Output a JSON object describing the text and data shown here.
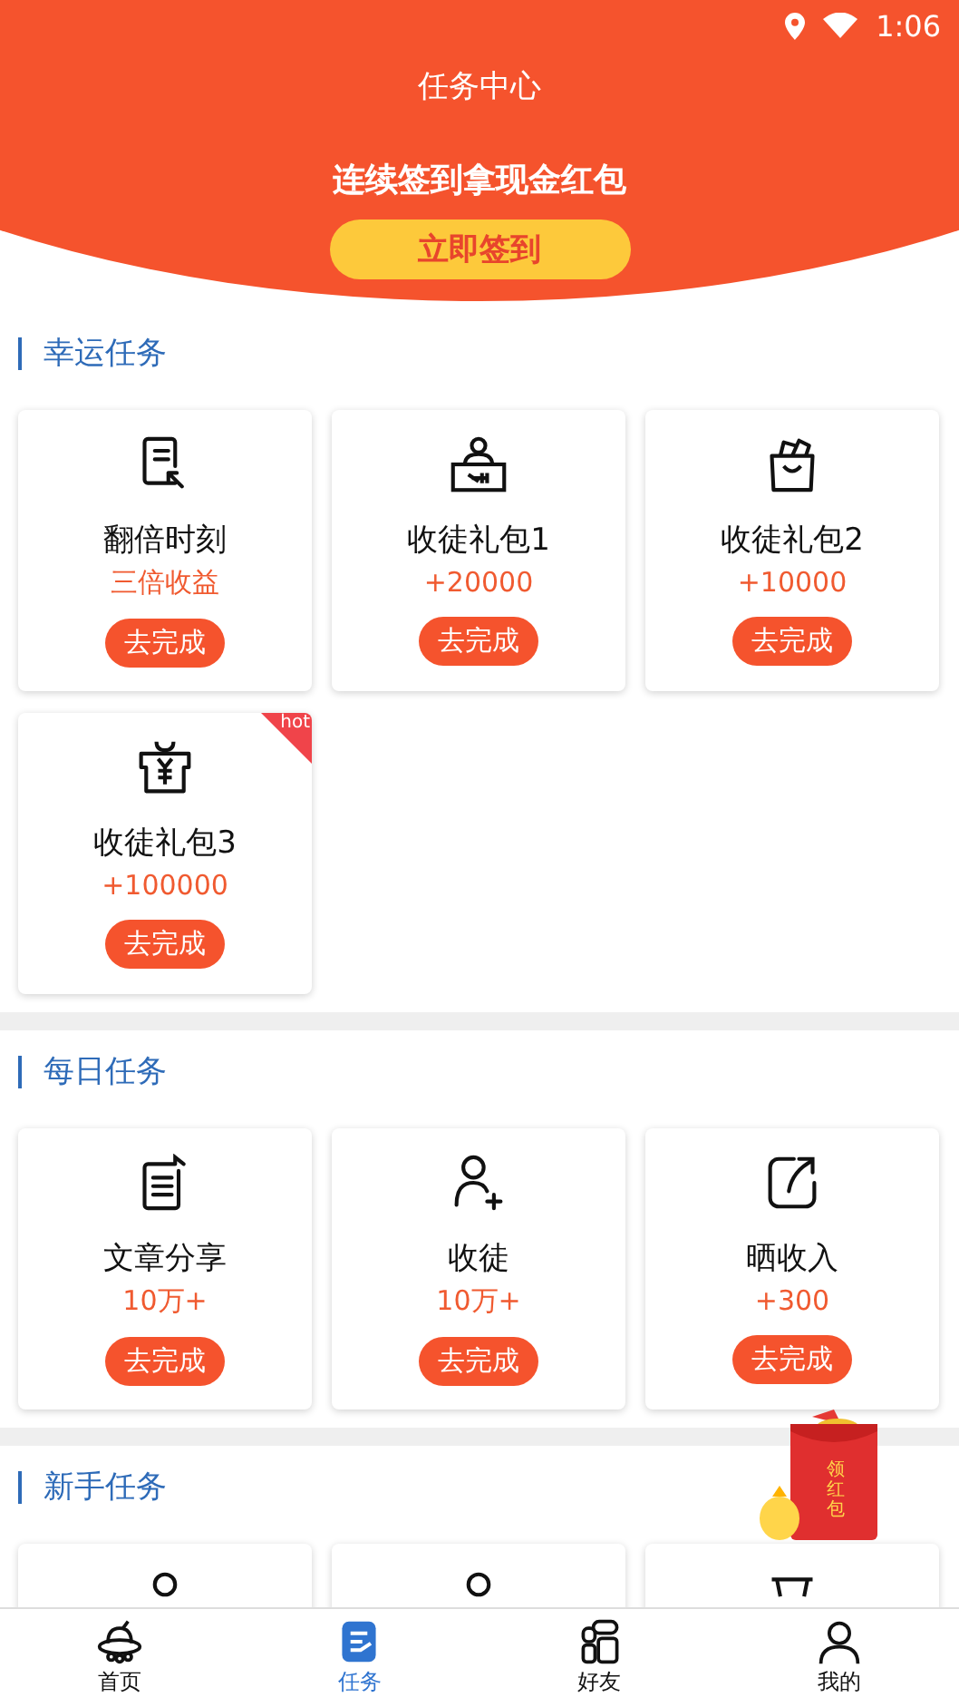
{
  "status_bar": {
    "time": "1:06"
  },
  "header": {
    "title": "任务中心",
    "headline": "连续签到拿现金红包",
    "button": "立即签到"
  },
  "sections": [
    {
      "title": "幸运任务",
      "cards": [
        {
          "kind": "double",
          "name": "翻倍时刻",
          "reward": "三倍收益",
          "button": "去完成"
        },
        {
          "kind": "recruit",
          "name": "收徒礼包1",
          "reward": "+20000",
          "button": "去完成"
        },
        {
          "kind": "bag",
          "name": "收徒礼包2",
          "reward": "+10000",
          "button": "去完成"
        },
        {
          "kind": "gift",
          "name": "收徒礼包3",
          "reward": "+100000",
          "button": "去完成",
          "badge": "hot"
        }
      ]
    },
    {
      "title": "每日任务",
      "cards": [
        {
          "kind": "article",
          "name": "文章分享",
          "reward": "10万+",
          "button": "去完成"
        },
        {
          "kind": "person",
          "name": "收徒",
          "reward": "10万+",
          "button": "去完成"
        },
        {
          "kind": "share",
          "name": "晒收入",
          "reward": "+300",
          "button": "去完成"
        }
      ]
    },
    {
      "title": "新手任务",
      "cards": [
        {
          "kind": "user"
        },
        {
          "kind": "user"
        },
        {
          "kind": "tray"
        }
      ]
    }
  ],
  "float_badge": {
    "label": "领红包"
  },
  "tabs": [
    {
      "label": "首页",
      "selected": false
    },
    {
      "label": "任务",
      "selected": true
    },
    {
      "label": "好友",
      "selected": false
    },
    {
      "label": "我的",
      "selected": false
    }
  ]
}
